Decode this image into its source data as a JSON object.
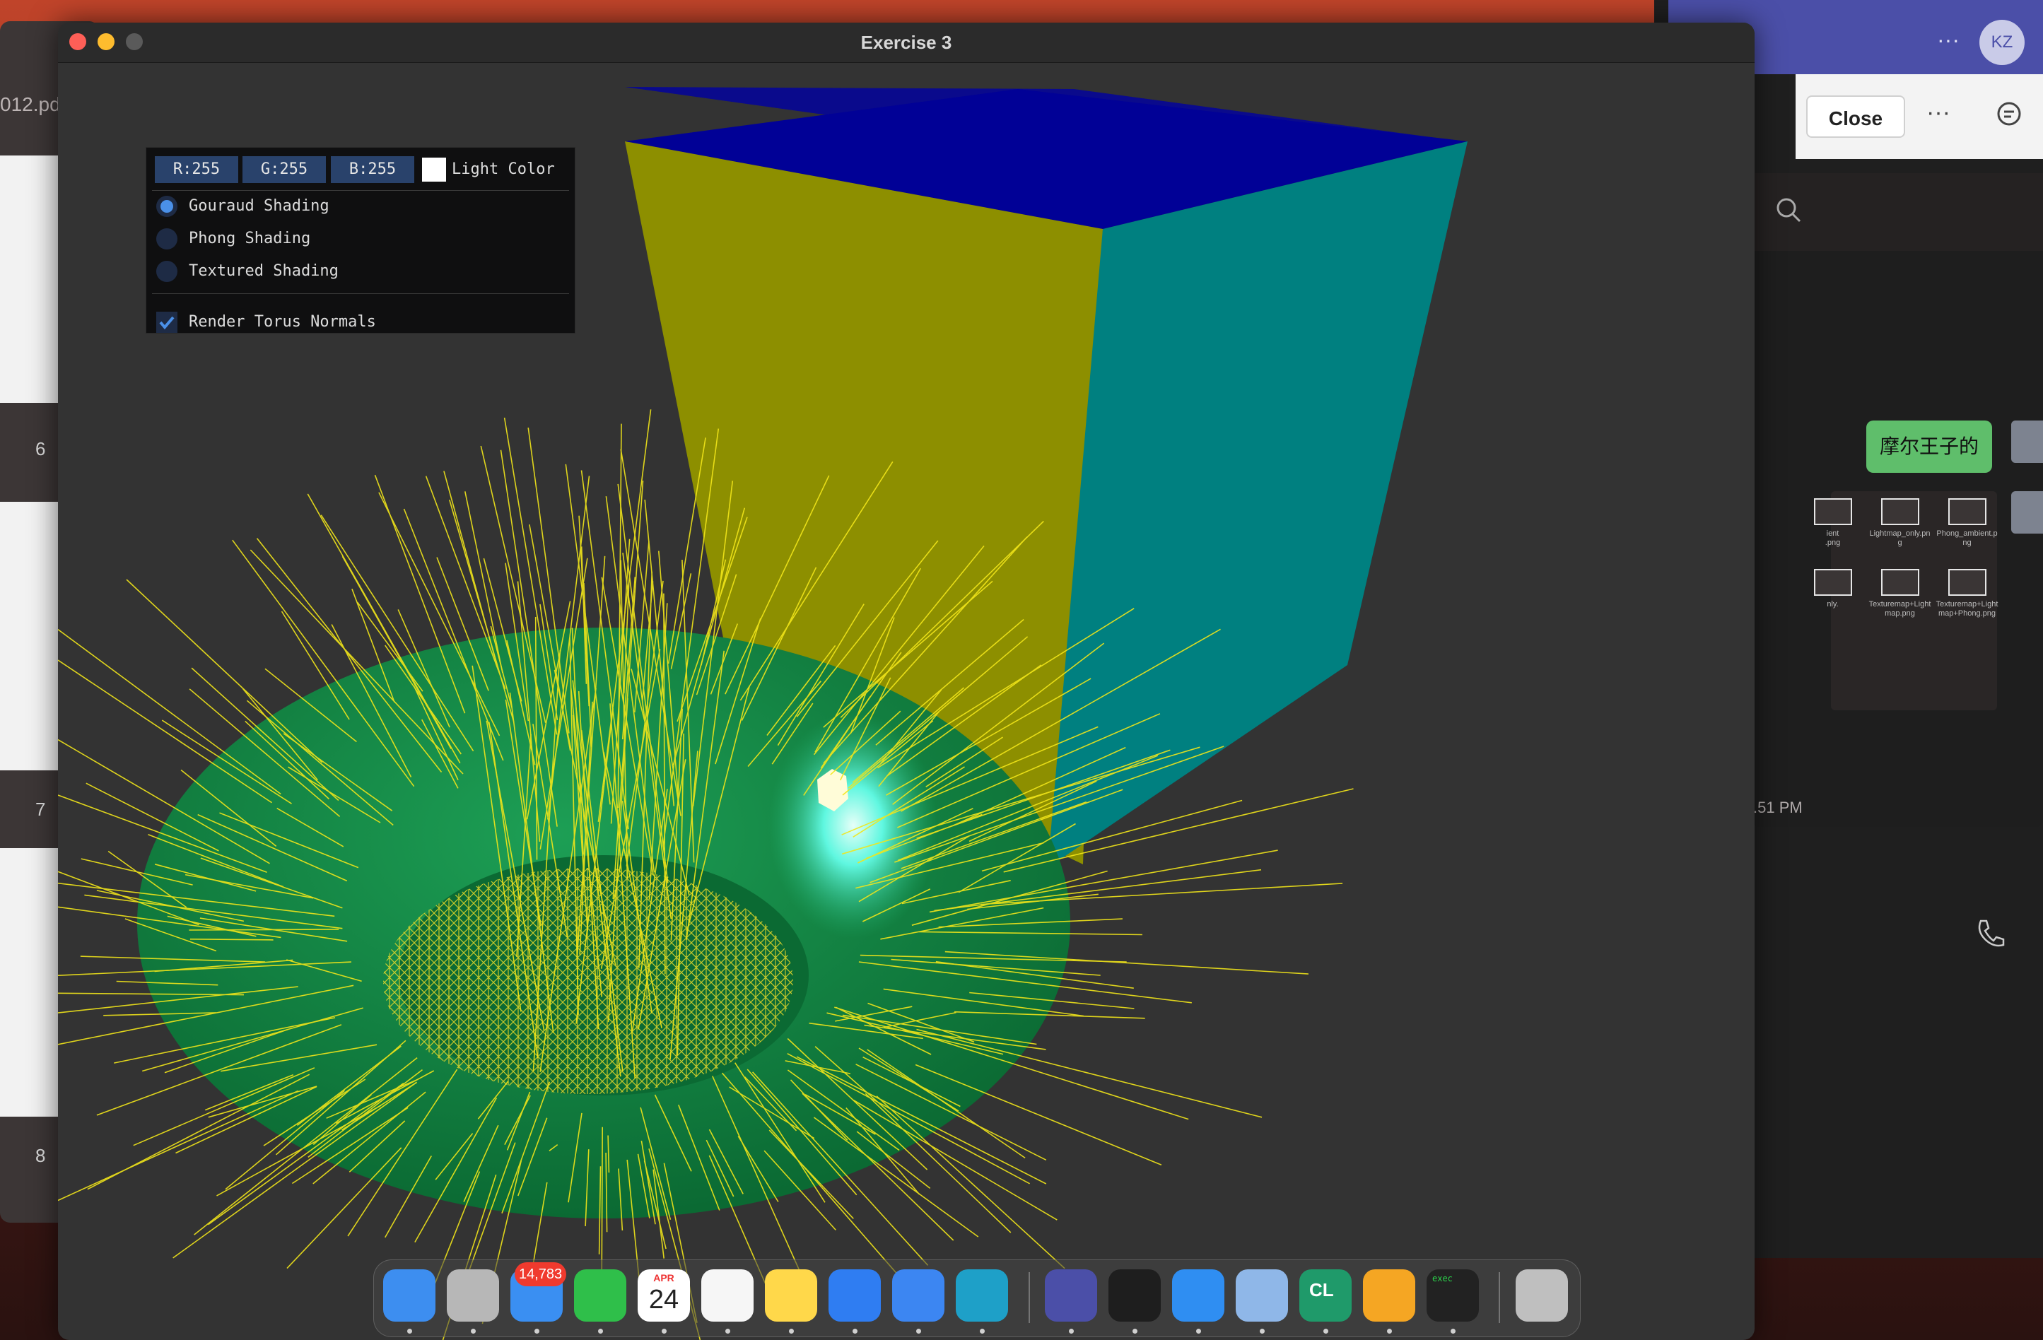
{
  "main_window": {
    "title": "Exercise 3"
  },
  "imgui_panel": {
    "r_value": "R:255",
    "g_value": "G:255",
    "b_value": "B:255",
    "light_color_label": "Light Color",
    "light_color_hex": "#ffffff",
    "shading_options": [
      {
        "label": "Gouraud Shading",
        "selected": true
      },
      {
        "label": "Phong Shading",
        "selected": false
      },
      {
        "label": "Textured Shading",
        "selected": false
      }
    ],
    "render_normals_label": "Render Torus Normals",
    "render_normals_checked": true
  },
  "pdf_window": {
    "title_fragment": "012.pd",
    "page_numbers": [
      "6",
      "7",
      "8"
    ]
  },
  "teams_window": {
    "close_label": "Close",
    "more_label": "···",
    "avatar_initials": "KZ",
    "brand_color": "#4b4fa8"
  },
  "chat_panel": {
    "message_text": "摩尔王子的",
    "message_time": ".51 PM",
    "files": [
      {
        "name": "ient\n.png"
      },
      {
        "name": "Lightmap_only.pn\ng"
      },
      {
        "name": "Phong_ambient.p\nng"
      },
      {
        "name": "nly."
      },
      {
        "name": "Texturemap+Light\nmap.png"
      },
      {
        "name": "Texturemap+Light\nmap+Phong.png"
      }
    ]
  },
  "dock": {
    "mail_badge": "14,783",
    "calendar_month": "APR",
    "calendar_day": "24",
    "terminal_label": "exec",
    "clion_label": "CL",
    "items": [
      {
        "name": "Finder",
        "icon": "finder-icon"
      },
      {
        "name": "Launchpad",
        "icon": "launchpad-icon"
      },
      {
        "name": "Mail",
        "icon": "mail-icon"
      },
      {
        "name": "WeChat",
        "icon": "wechat-icon"
      },
      {
        "name": "Calendar",
        "icon": "calendar-icon"
      },
      {
        "name": "Reminders",
        "icon": "reminders-icon"
      },
      {
        "name": "Notes",
        "icon": "notes-icon"
      },
      {
        "name": "Keynote",
        "icon": "keynote-icon"
      },
      {
        "name": "Xcode",
        "icon": "xcode-icon"
      },
      {
        "name": "Edge",
        "icon": "edge-icon"
      },
      {
        "name": "Teams",
        "icon": "teams-icon"
      },
      {
        "name": "Terminal",
        "icon": "terminal-icon"
      },
      {
        "name": "Safari",
        "icon": "safari-icon"
      },
      {
        "name": "Preview",
        "icon": "preview-icon"
      },
      {
        "name": "CLion",
        "icon": "clion-icon"
      },
      {
        "name": "Pages",
        "icon": "pages-icon"
      },
      {
        "name": "Exec",
        "icon": "exec-icon"
      },
      {
        "name": "Trash",
        "icon": "trash-icon"
      }
    ]
  }
}
